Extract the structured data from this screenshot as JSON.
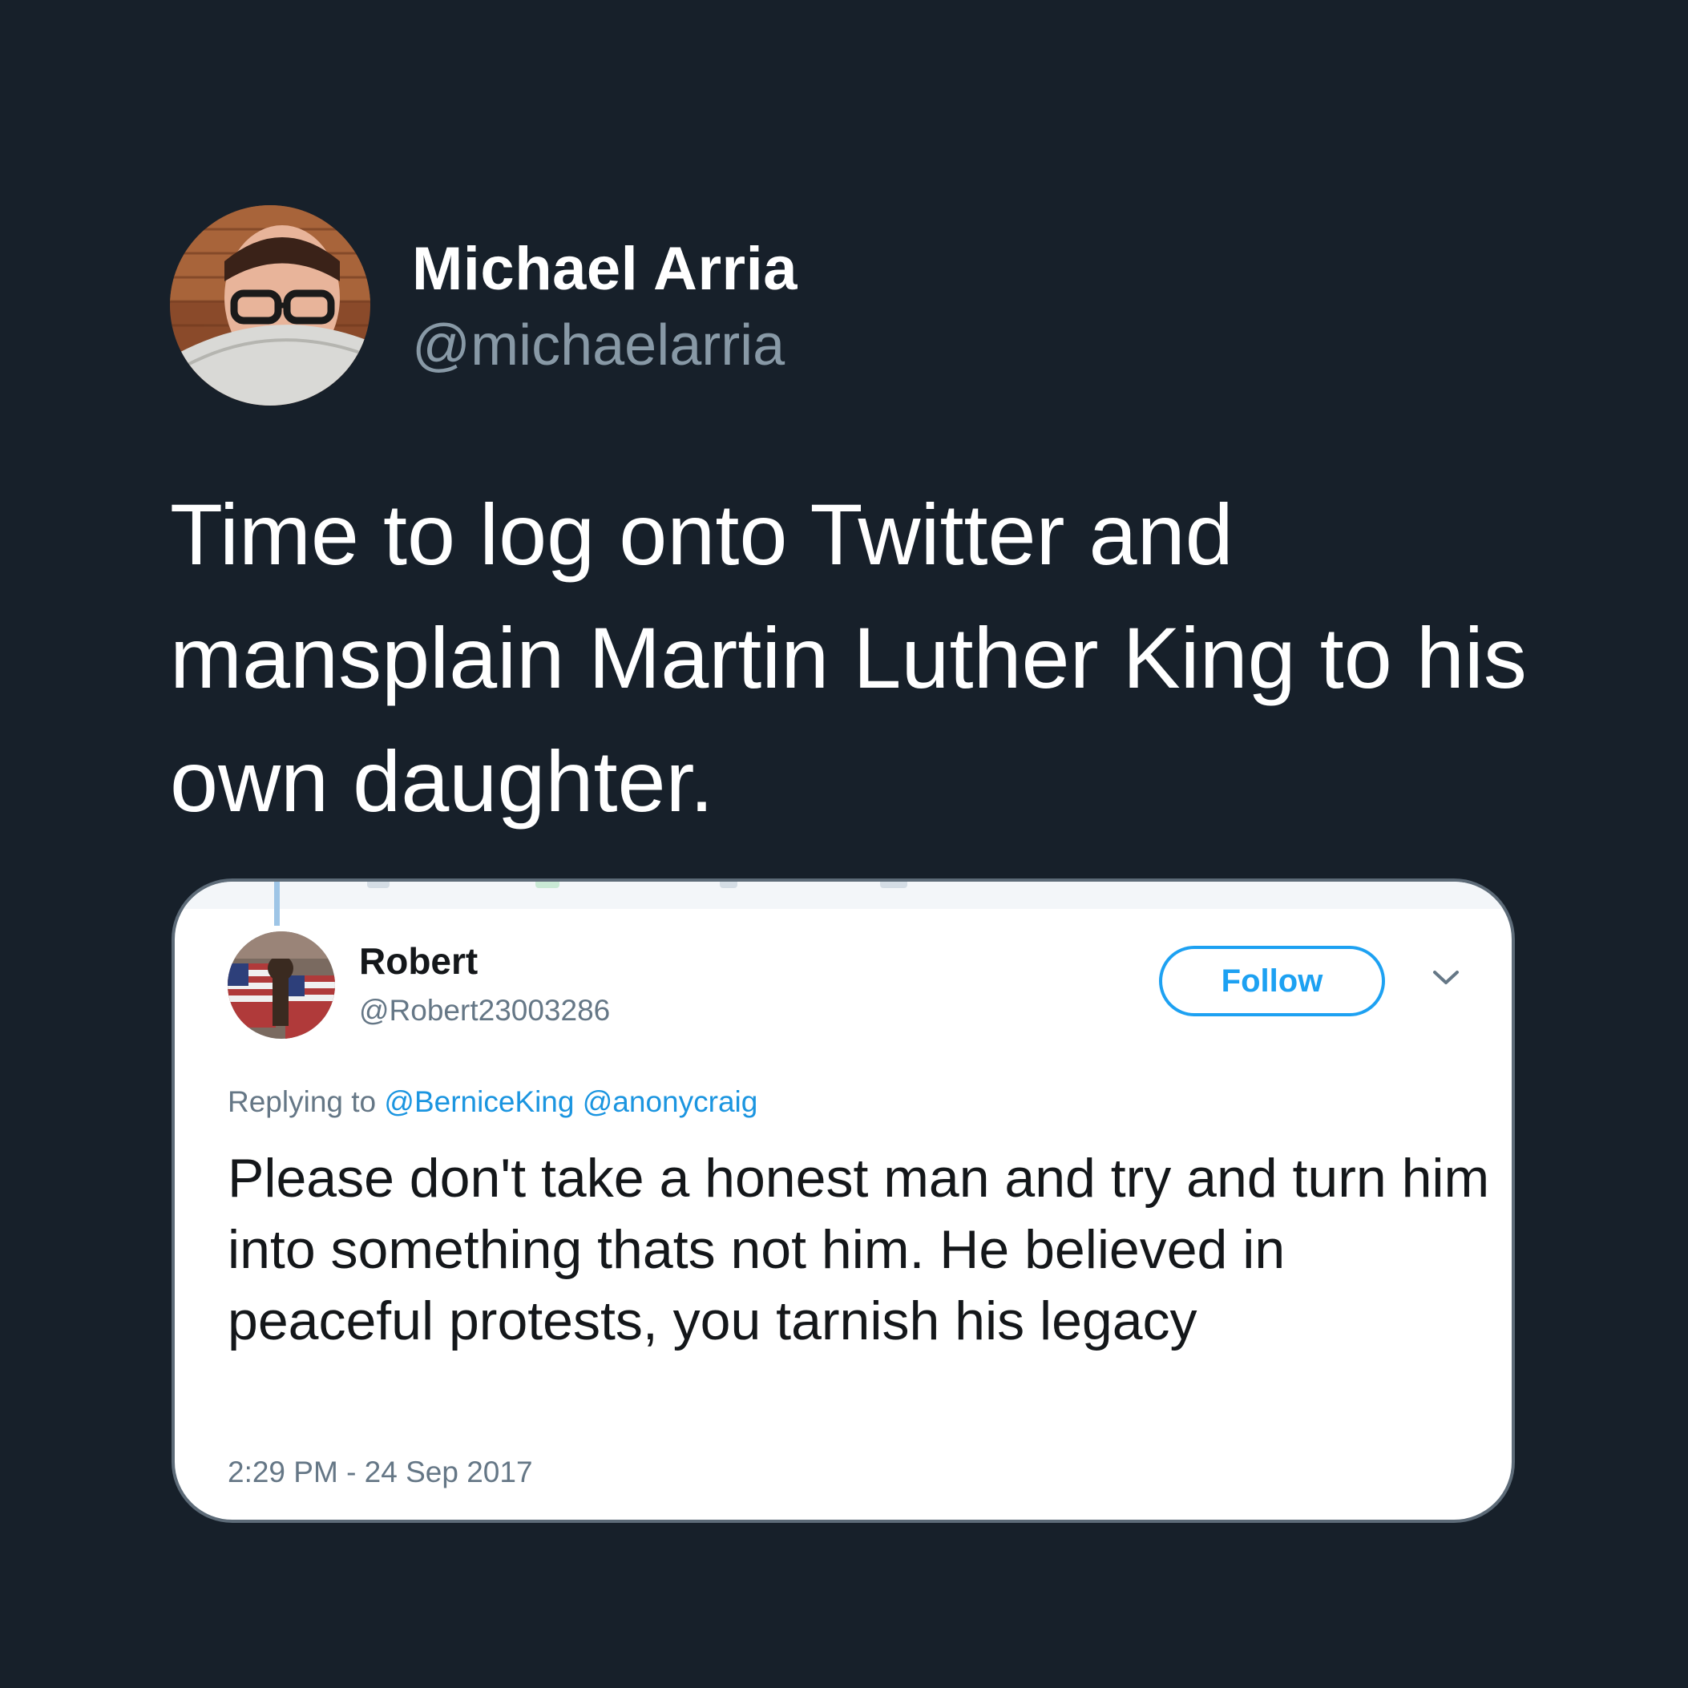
{
  "author": {
    "name": "Michael Arria",
    "handle": "@michaelarria",
    "avatar_icon": "profile-photo"
  },
  "tweet": {
    "text": "Time to log onto Twitter and mansplain Martin Luther King to his own daughter."
  },
  "quoted_screenshot": {
    "name": "Robert",
    "handle": "@Robert23003286",
    "follow_label": "Follow",
    "menu_icon": "chevron-down-icon",
    "replying_to_prefix": "Replying to",
    "mentions": [
      "@BerniceKing",
      "@anonycraig"
    ],
    "text": "Please don't take a honest man and try and turn him into something thats not him. He believed in peaceful protests, you tarnish his legacy",
    "timestamp": "2:29 PM - 24 Sep 2017"
  },
  "colors": {
    "background": "#17202a",
    "accent": "#1da1f2",
    "mention": "#1b95e0",
    "secondary_text": "#8899a6"
  }
}
